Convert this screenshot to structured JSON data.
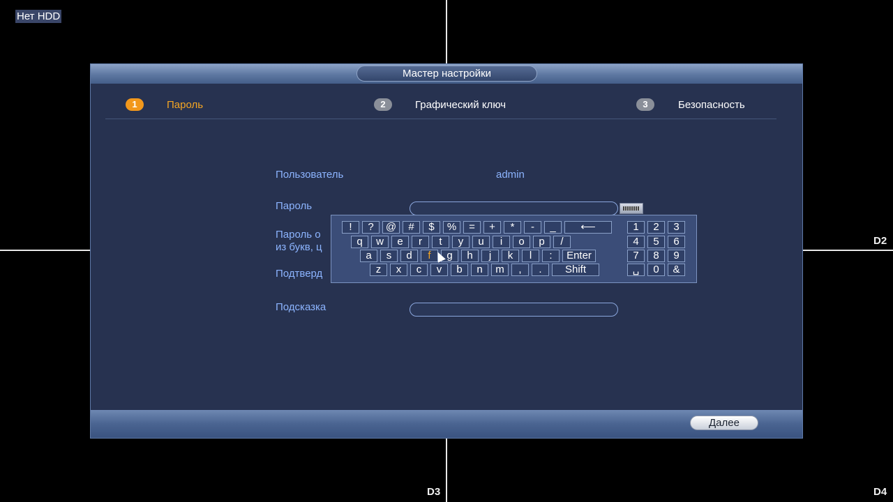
{
  "screen": {
    "hdd_status": "Нет HDD",
    "cameras": [
      "D2",
      "D3",
      "D4"
    ]
  },
  "wizard": {
    "title": "Мастер настройки",
    "steps": [
      {
        "num": "1",
        "label": "Пароль",
        "active": true
      },
      {
        "num": "2",
        "label": "Графический ключ",
        "active": false
      },
      {
        "num": "3",
        "label": "Безопасность",
        "active": false
      }
    ],
    "fields": {
      "user_label": "Пользователь",
      "user_value": "admin",
      "password_label": "Пароль",
      "password_value": "",
      "confirm_hint_line1": "Пароль о",
      "confirm_hint_line2": "из букв, ц",
      "confirm_label": "Подтверд",
      "hint_label": "Подсказка",
      "hint_value": ""
    },
    "next_label": "Далее"
  },
  "keyboard": {
    "row1": [
      "!",
      "?",
      "@",
      "#",
      "$",
      "%",
      "=",
      "+",
      "*",
      "-",
      "_",
      "⟵"
    ],
    "row2": [
      "q",
      "w",
      "e",
      "r",
      "t",
      "y",
      "u",
      "i",
      "o",
      "p",
      "/"
    ],
    "row3": [
      "a",
      "s",
      "d",
      "f",
      "g",
      "h",
      "j",
      "k",
      "l",
      ":",
      "Enter"
    ],
    "row4": [
      "z",
      "x",
      "c",
      "v",
      "b",
      "n",
      "m",
      ",",
      ".",
      "Shift"
    ],
    "num1": [
      "1",
      "2",
      "3"
    ],
    "num2": [
      "4",
      "5",
      "6"
    ],
    "num3": [
      "7",
      "8",
      "9"
    ],
    "num4": [
      "␣",
      "0",
      "&"
    ],
    "highlighted": "f"
  }
}
